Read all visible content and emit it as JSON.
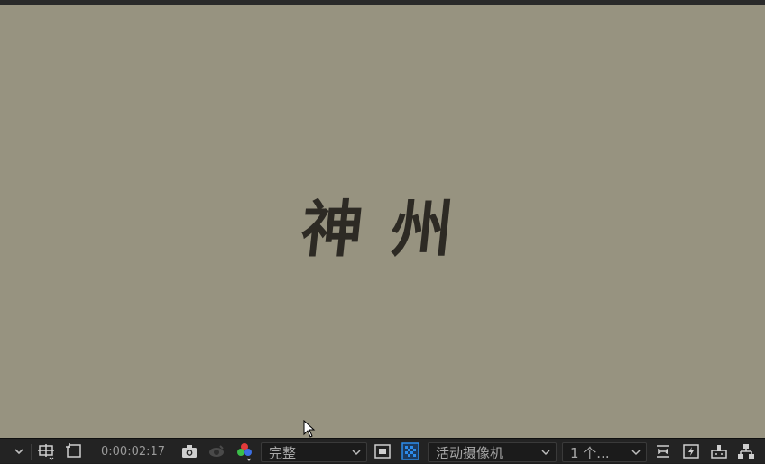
{
  "composition": {
    "title_text": "神 州"
  },
  "toolbar": {
    "timecode": "0:00:02:17",
    "resolution": {
      "selected": "完整"
    },
    "camera": {
      "selected": "活动摄像机"
    },
    "views": {
      "selected": "1 个..."
    }
  },
  "colors": {
    "viewer_bg": "#979380",
    "toolbar_bg": "#232323",
    "accent_blue": "#2d8ceb"
  },
  "icons": [
    "chevron-down-icon",
    "region-of-interest-icon",
    "transparency-grid-icon",
    "snapshot-camera-icon",
    "show-snapshot-icon",
    "color-channels-icon",
    "toggle-mask-icon",
    "checkerboard-icon",
    "reset-exposure-icon",
    "fast-preview-icon",
    "timeline-icon",
    "flowchart-icon"
  ]
}
